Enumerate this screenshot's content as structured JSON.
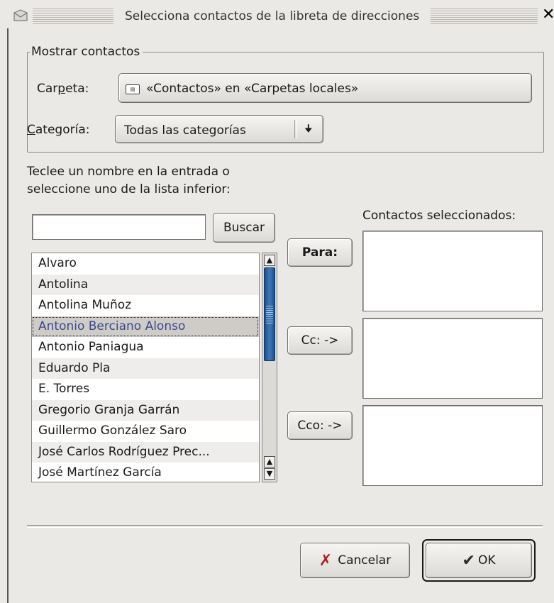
{
  "window": {
    "title": "Selecciona contactos de la libreta de direcciones"
  },
  "group": {
    "legend": "Mostrar contactos",
    "folder_label": "Carpeta:",
    "folder_value": "«Contactos» en «Carpetas locales»",
    "category_label": "Categoría:",
    "category_value": "Todas las categorías"
  },
  "instructions": {
    "line1": "Teclee un nombre en la entrada o",
    "line2": "seleccione uno de la lista inferior:"
  },
  "search": {
    "value": "",
    "button": "Buscar"
  },
  "contacts": [
    "Alvaro",
    "Antolina",
    "Antolina Muñoz",
    "Antonio Berciano Alonso",
    "Antonio Paniagua",
    "Eduardo Pla",
    "E. Torres",
    "Gregorio Granja Garrán",
    "Guillermo González Saro",
    "José Carlos Rodríguez Prec...",
    "José Martínez García"
  ],
  "selected_contact": "Antonio Berciano Alonso",
  "selected_panel": {
    "title": "Contactos seleccionados:",
    "to_button": "Para:",
    "cc_button": "Cc: ->",
    "bcc_button": "Cco: ->"
  },
  "footer": {
    "cancel": "Cancelar",
    "ok": "OK"
  }
}
